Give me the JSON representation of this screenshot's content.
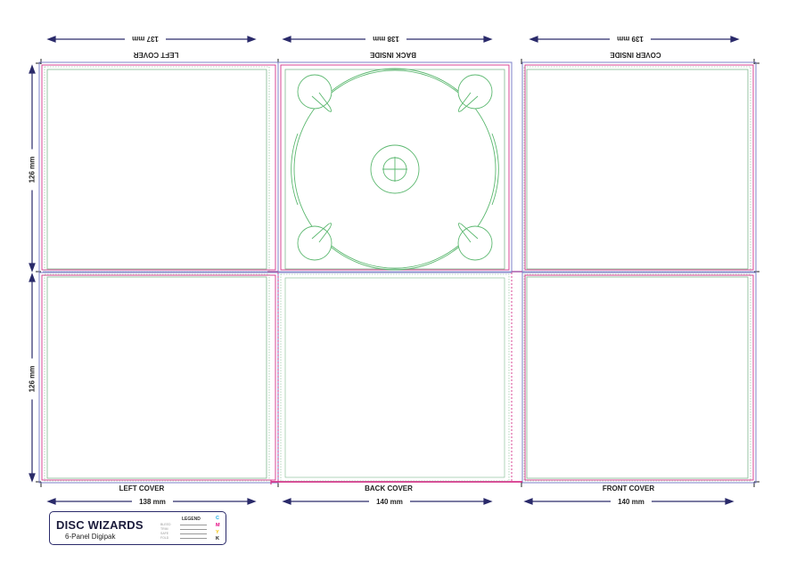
{
  "panels_top": [
    {
      "label": "LEFT COVER",
      "dimension": "137 mm"
    },
    {
      "label": "BACK INSIDE",
      "dimension": "138 mm"
    },
    {
      "label": "COVER  INSIDE",
      "dimension": "139 mm"
    }
  ],
  "panels_bottom": [
    {
      "label": "LEFT COVER",
      "dimension": "138 mm"
    },
    {
      "label": "BACK COVER",
      "dimension": "140 mm"
    },
    {
      "label": "FRONT COVER",
      "dimension": "140 mm"
    }
  ],
  "height_labels": [
    "126 mm",
    "126 mm"
  ],
  "title_block": {
    "brand": "DISC WIZARDS",
    "subtitle": "6-Panel Digipak",
    "legend_title": "LEGEND",
    "legend_rows": [
      "BLEED",
      "TRIM",
      "SAFE",
      "FOLD"
    ],
    "cmyk": [
      "C",
      "M",
      "Y",
      "K"
    ]
  },
  "colors": {
    "dimension_line": "#2a2a6a",
    "bleed": "#7d82c8",
    "trim": "#d6338a",
    "safe": "#7fb88e",
    "tray": "#5cb870",
    "cyan": "#1eaee6",
    "magenta": "#e4007f",
    "yellow": "#f2c200",
    "black": "#111111"
  }
}
